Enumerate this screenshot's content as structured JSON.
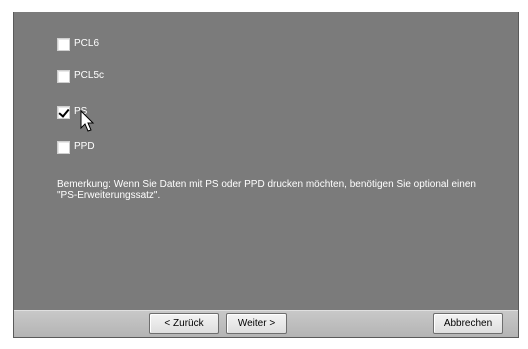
{
  "options": [
    {
      "label": "PCL6",
      "checked": false
    },
    {
      "label": "PCL5c",
      "checked": false
    },
    {
      "label": "PS",
      "checked": true
    },
    {
      "label": "PPD",
      "checked": false
    }
  ],
  "note": "Bemerkung: Wenn Sie Daten mit PS oder PPD drucken möchten, benötigen Sie optional einen \"PS-Erweiterungssatz\".",
  "buttons": {
    "back": "< Zurück",
    "next": "Weiter >",
    "cancel": "Abbrechen"
  }
}
